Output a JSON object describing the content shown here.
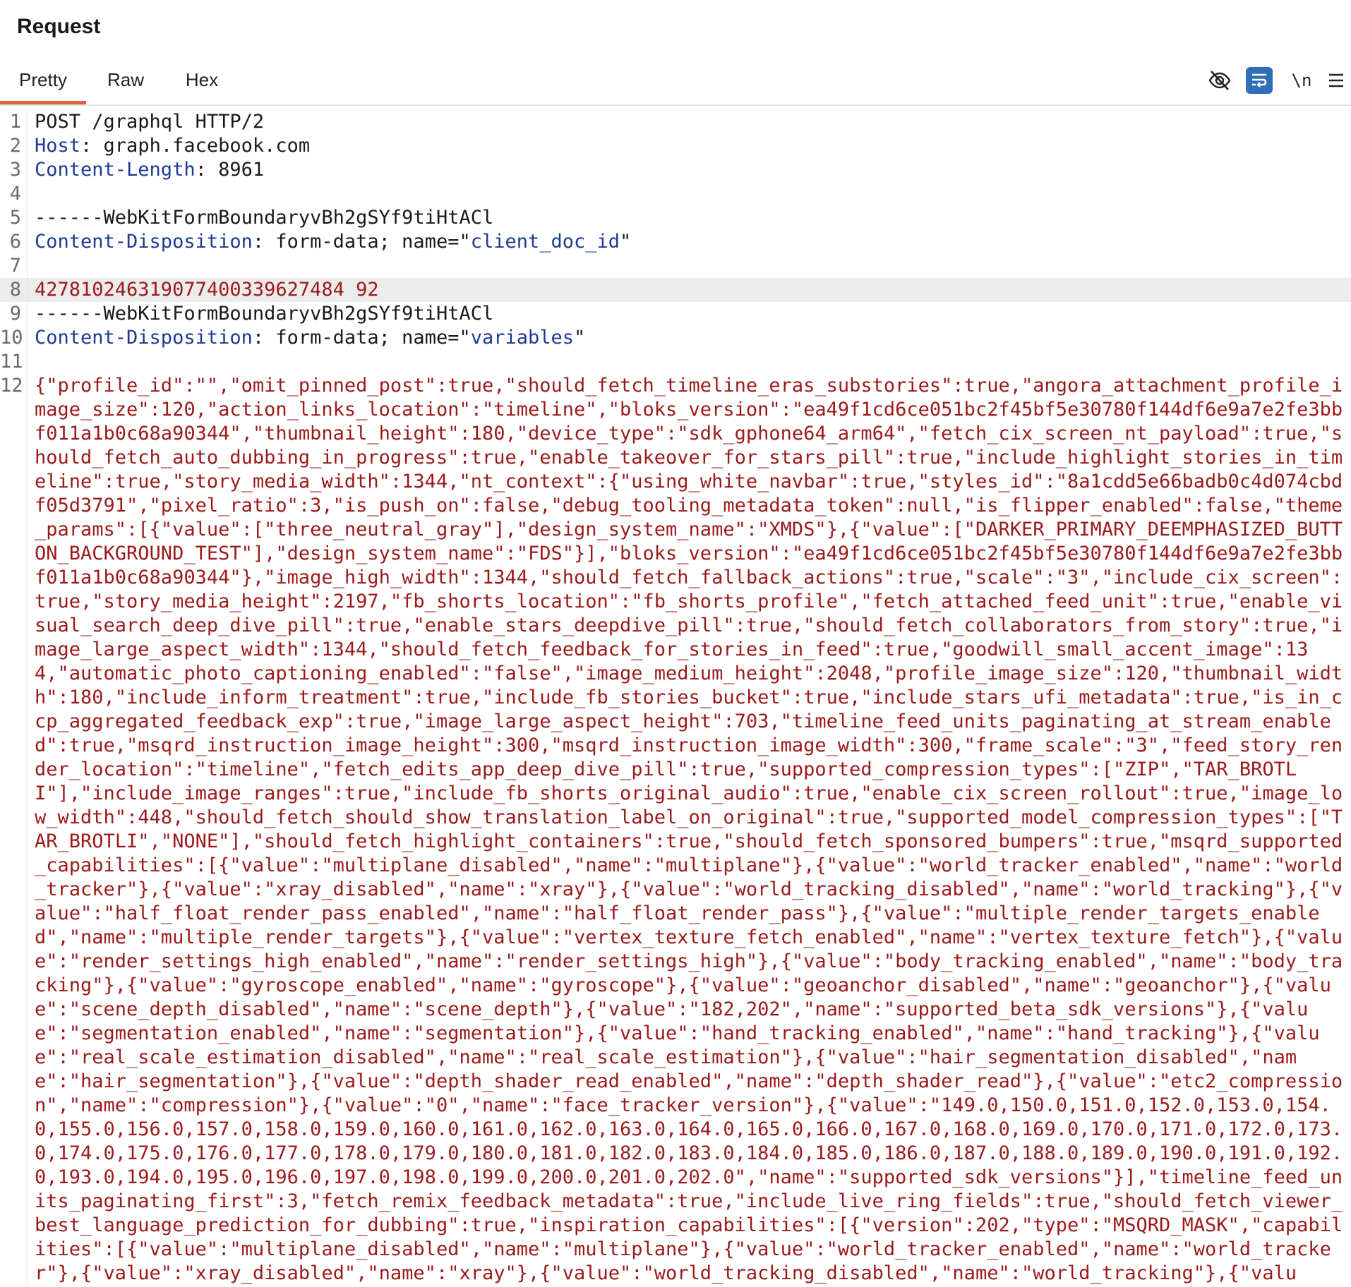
{
  "panel": {
    "title": "Request"
  },
  "tabs": [
    {
      "label": "Pretty"
    },
    {
      "label": "Raw"
    },
    {
      "label": "Hex"
    }
  ],
  "toolbar": {
    "hide_icon": "eye-slash-icon",
    "wrap_icon": "word-wrap-icon",
    "newline_label": "\\n",
    "menu_icon": "hamburger-menu-icon"
  },
  "colors": {
    "active_tab_underline": "#e0622f",
    "wrap_button_bg": "#2f6fb8",
    "header_name": "#1f3a93",
    "body_value": "#9b1a1a",
    "highlight_row": "#ececec"
  },
  "editor": {
    "line_numbers": [
      "1",
      "2",
      "3",
      "4",
      "5",
      "6",
      "7",
      "8",
      "9",
      "10",
      "11",
      "12"
    ],
    "l1": "POST /graphql HTTP/2",
    "l2_name": "Host",
    "l2_sep": ": ",
    "l2_value": "graph.facebook.com",
    "l3_name": "Content-Length",
    "l3_sep": ": ",
    "l3_value": "8961",
    "l5": "------WebKitFormBoundaryvBh2gSYf9tiHtACl",
    "l6_name": "Content-Disposition",
    "l6_pre": ": form-data; name=\"",
    "l6_value": "client_doc_id",
    "l6_post": "\"",
    "l8": "427810246319077400339627484 92",
    "l9": "------WebKitFormBoundaryvBh2gSYf9tiHtACl",
    "l10_name": "Content-Disposition",
    "l10_pre": ": form-data; name=\"",
    "l10_value": "variables",
    "l10_post": "\"",
    "l12": "{\"profile_id\":\"\",\"omit_pinned_post\":true,\"should_fetch_timeline_eras_substories\":true,\"angora_attachment_profile_image_size\":120,\"action_links_location\":\"timeline\",\"bloks_version\":\"ea49f1cd6ce051bc2f45bf5e30780f144df6e9a7e2fe3bbf011a1b0c68a90344\",\"thumbnail_height\":180,\"device_type\":\"sdk_gphone64_arm64\",\"fetch_cix_screen_nt_payload\":true,\"should_fetch_auto_dubbing_in_progress\":true,\"enable_takeover_for_stars_pill\":true,\"include_highlight_stories_in_timeline\":true,\"story_media_width\":1344,\"nt_context\":{\"using_white_navbar\":true,\"styles_id\":\"8a1cdd5e66badb0c4d074cbdf05d3791\",\"pixel_ratio\":3,\"is_push_on\":false,\"debug_tooling_metadata_token\":null,\"is_flipper_enabled\":false,\"theme_params\":[{\"value\":[\"three_neutral_gray\"],\"design_system_name\":\"XMDS\"},{\"value\":[\"DARKER_PRIMARY_DEEMPHASIZED_BUTTON_BACKGROUND_TEST\"],\"design_system_name\":\"FDS\"}],\"bloks_version\":\"ea49f1cd6ce051bc2f45bf5e30780f144df6e9a7e2fe3bbf011a1b0c68a90344\"},\"image_high_width\":1344,\"should_fetch_fallback_actions\":true,\"scale\":\"3\",\"include_cix_screen\":true,\"story_media_height\":2197,\"fb_shorts_location\":\"fb_shorts_profile\",\"fetch_attached_feed_unit\":true,\"enable_visual_search_deep_dive_pill\":true,\"enable_stars_deepdive_pill\":true,\"should_fetch_collaborators_from_story\":true,\"image_large_aspect_width\":1344,\"should_fetch_feedback_for_stories_in_feed\":true,\"goodwill_small_accent_image\":134,\"automatic_photo_captioning_enabled\":\"false\",\"image_medium_height\":2048,\"profile_image_size\":120,\"thumbnail_width\":180,\"include_inform_treatment\":true,\"include_fb_stories_bucket\":true,\"include_stars_ufi_metadata\":true,\"is_in_ccp_aggregated_feedback_exp\":true,\"image_large_aspect_height\":703,\"timeline_feed_units_paginating_at_stream_enabled\":true,\"msqrd_instruction_image_height\":300,\"msqrd_instruction_image_width\":300,\"frame_scale\":\"3\",\"feed_story_render_location\":\"timeline\",\"fetch_edits_app_deep_dive_pill\":true,\"supported_compression_types\":[\"ZIP\",\"TAR_BROTLI\"],\"include_image_ranges\":true,\"include_fb_shorts_original_audio\":true,\"enable_cix_screen_rollout\":true,\"image_low_width\":448,\"should_fetch_should_show_translation_label_on_original\":true,\"supported_model_compression_types\":[\"TAR_BROTLI\",\"NONE\"],\"should_fetch_highlight_containers\":true,\"should_fetch_sponsored_bumpers\":true,\"msqrd_supported_capabilities\":[{\"value\":\"multiplane_disabled\",\"name\":\"multiplane\"},{\"value\":\"world_tracker_enabled\",\"name\":\"world_tracker\"},{\"value\":\"xray_disabled\",\"name\":\"xray\"},{\"value\":\"world_tracking_disabled\",\"name\":\"world_tracking\"},{\"value\":\"half_float_render_pass_enabled\",\"name\":\"half_float_render_pass\"},{\"value\":\"multiple_render_targets_enabled\",\"name\":\"multiple_render_targets\"},{\"value\":\"vertex_texture_fetch_enabled\",\"name\":\"vertex_texture_fetch\"},{\"value\":\"render_settings_high_enabled\",\"name\":\"render_settings_high\"},{\"value\":\"body_tracking_enabled\",\"name\":\"body_tracking\"},{\"value\":\"gyroscope_enabled\",\"name\":\"gyroscope\"},{\"value\":\"geoanchor_disabled\",\"name\":\"geoanchor\"},{\"value\":\"scene_depth_disabled\",\"name\":\"scene_depth\"},{\"value\":\"182,202\",\"name\":\"supported_beta_sdk_versions\"},{\"value\":\"segmentation_enabled\",\"name\":\"segmentation\"},{\"value\":\"hand_tracking_enabled\",\"name\":\"hand_tracking\"},{\"value\":\"real_scale_estimation_disabled\",\"name\":\"real_scale_estimation\"},{\"value\":\"hair_segmentation_disabled\",\"name\":\"hair_segmentation\"},{\"value\":\"depth_shader_read_enabled\",\"name\":\"depth_shader_read\"},{\"value\":\"etc2_compression\",\"name\":\"compression\"},{\"value\":\"0\",\"name\":\"face_tracker_version\"},{\"value\":\"149.0,150.0,151.0,152.0,153.0,154.0,155.0,156.0,157.0,158.0,159.0,160.0,161.0,162.0,163.0,164.0,165.0,166.0,167.0,168.0,169.0,170.0,171.0,172.0,173.0,174.0,175.0,176.0,177.0,178.0,179.0,180.0,181.0,182.0,183.0,184.0,185.0,186.0,187.0,188.0,189.0,190.0,191.0,192.0,193.0,194.0,195.0,196.0,197.0,198.0,199.0,200.0,201.0,202.0\",\"name\":\"supported_sdk_versions\"}],\"timeline_feed_units_paginating_first\":3,\"fetch_remix_feedback_metadata\":true,\"include_live_ring_fields\":true,\"should_fetch_viewer_best_language_prediction_for_dubbing\":true,\"inspiration_capabilities\":[{\"version\":202,\"type\":\"MSQRD_MASK\",\"capabilities\":[{\"value\":\"multiplane_disabled\",\"name\":\"multiplane\"},{\"value\":\"world_tracker_enabled\",\"name\":\"world_tracker\"},{\"value\":\"xray_disabled\",\"name\":\"xray\"},{\"value\":\"world_tracking_disabled\",\"name\":\"world_tracking\"},{\"value\":\"half_float_render_pass_enabled\",\"name\":\"half_float_render_pass\"},{\"value\":\"multiple_render_targets"
  }
}
